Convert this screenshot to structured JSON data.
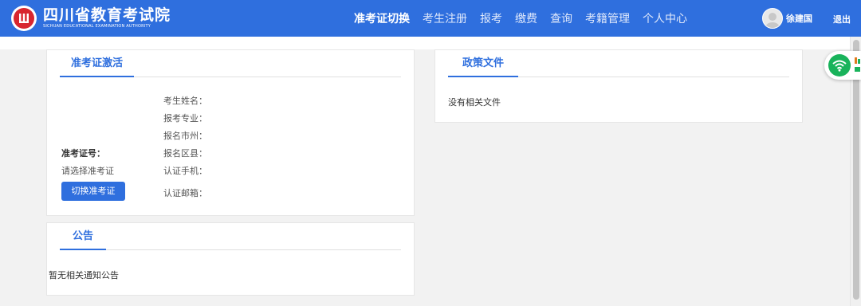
{
  "header": {
    "logo_cn": "四川省教育考试院",
    "logo_en": "SICHUAN EDUCATIONAL EXAMINATION AUTHORITY",
    "nav": [
      {
        "label": "准考证切换",
        "active": true
      },
      {
        "label": "考生注册",
        "active": false
      },
      {
        "label": "报考",
        "active": false
      },
      {
        "label": "缴费",
        "active": false
      },
      {
        "label": "查询",
        "active": false
      },
      {
        "label": "考籍管理",
        "active": false
      },
      {
        "label": "个人中心",
        "active": false
      }
    ],
    "username": "徐建国",
    "logout": "退出"
  },
  "activation": {
    "title": "准考证激活",
    "ticket_label": "准考证号：",
    "ticket_value": "请选择准考证",
    "switch_button": "切换准考证",
    "fields": [
      "考生姓名：",
      "报考专业：",
      "报名市州：",
      "报名区县：",
      "认证手机：",
      "认证邮箱："
    ]
  },
  "policy": {
    "title": "政策文件",
    "empty_text": "没有相关文件"
  },
  "notice": {
    "title": "公告",
    "empty_text": "暂无相关通知公告"
  },
  "colors": {
    "brand": "#2f6fde",
    "logo_red": "#d8262f",
    "wifi_green": "#19b35b"
  }
}
